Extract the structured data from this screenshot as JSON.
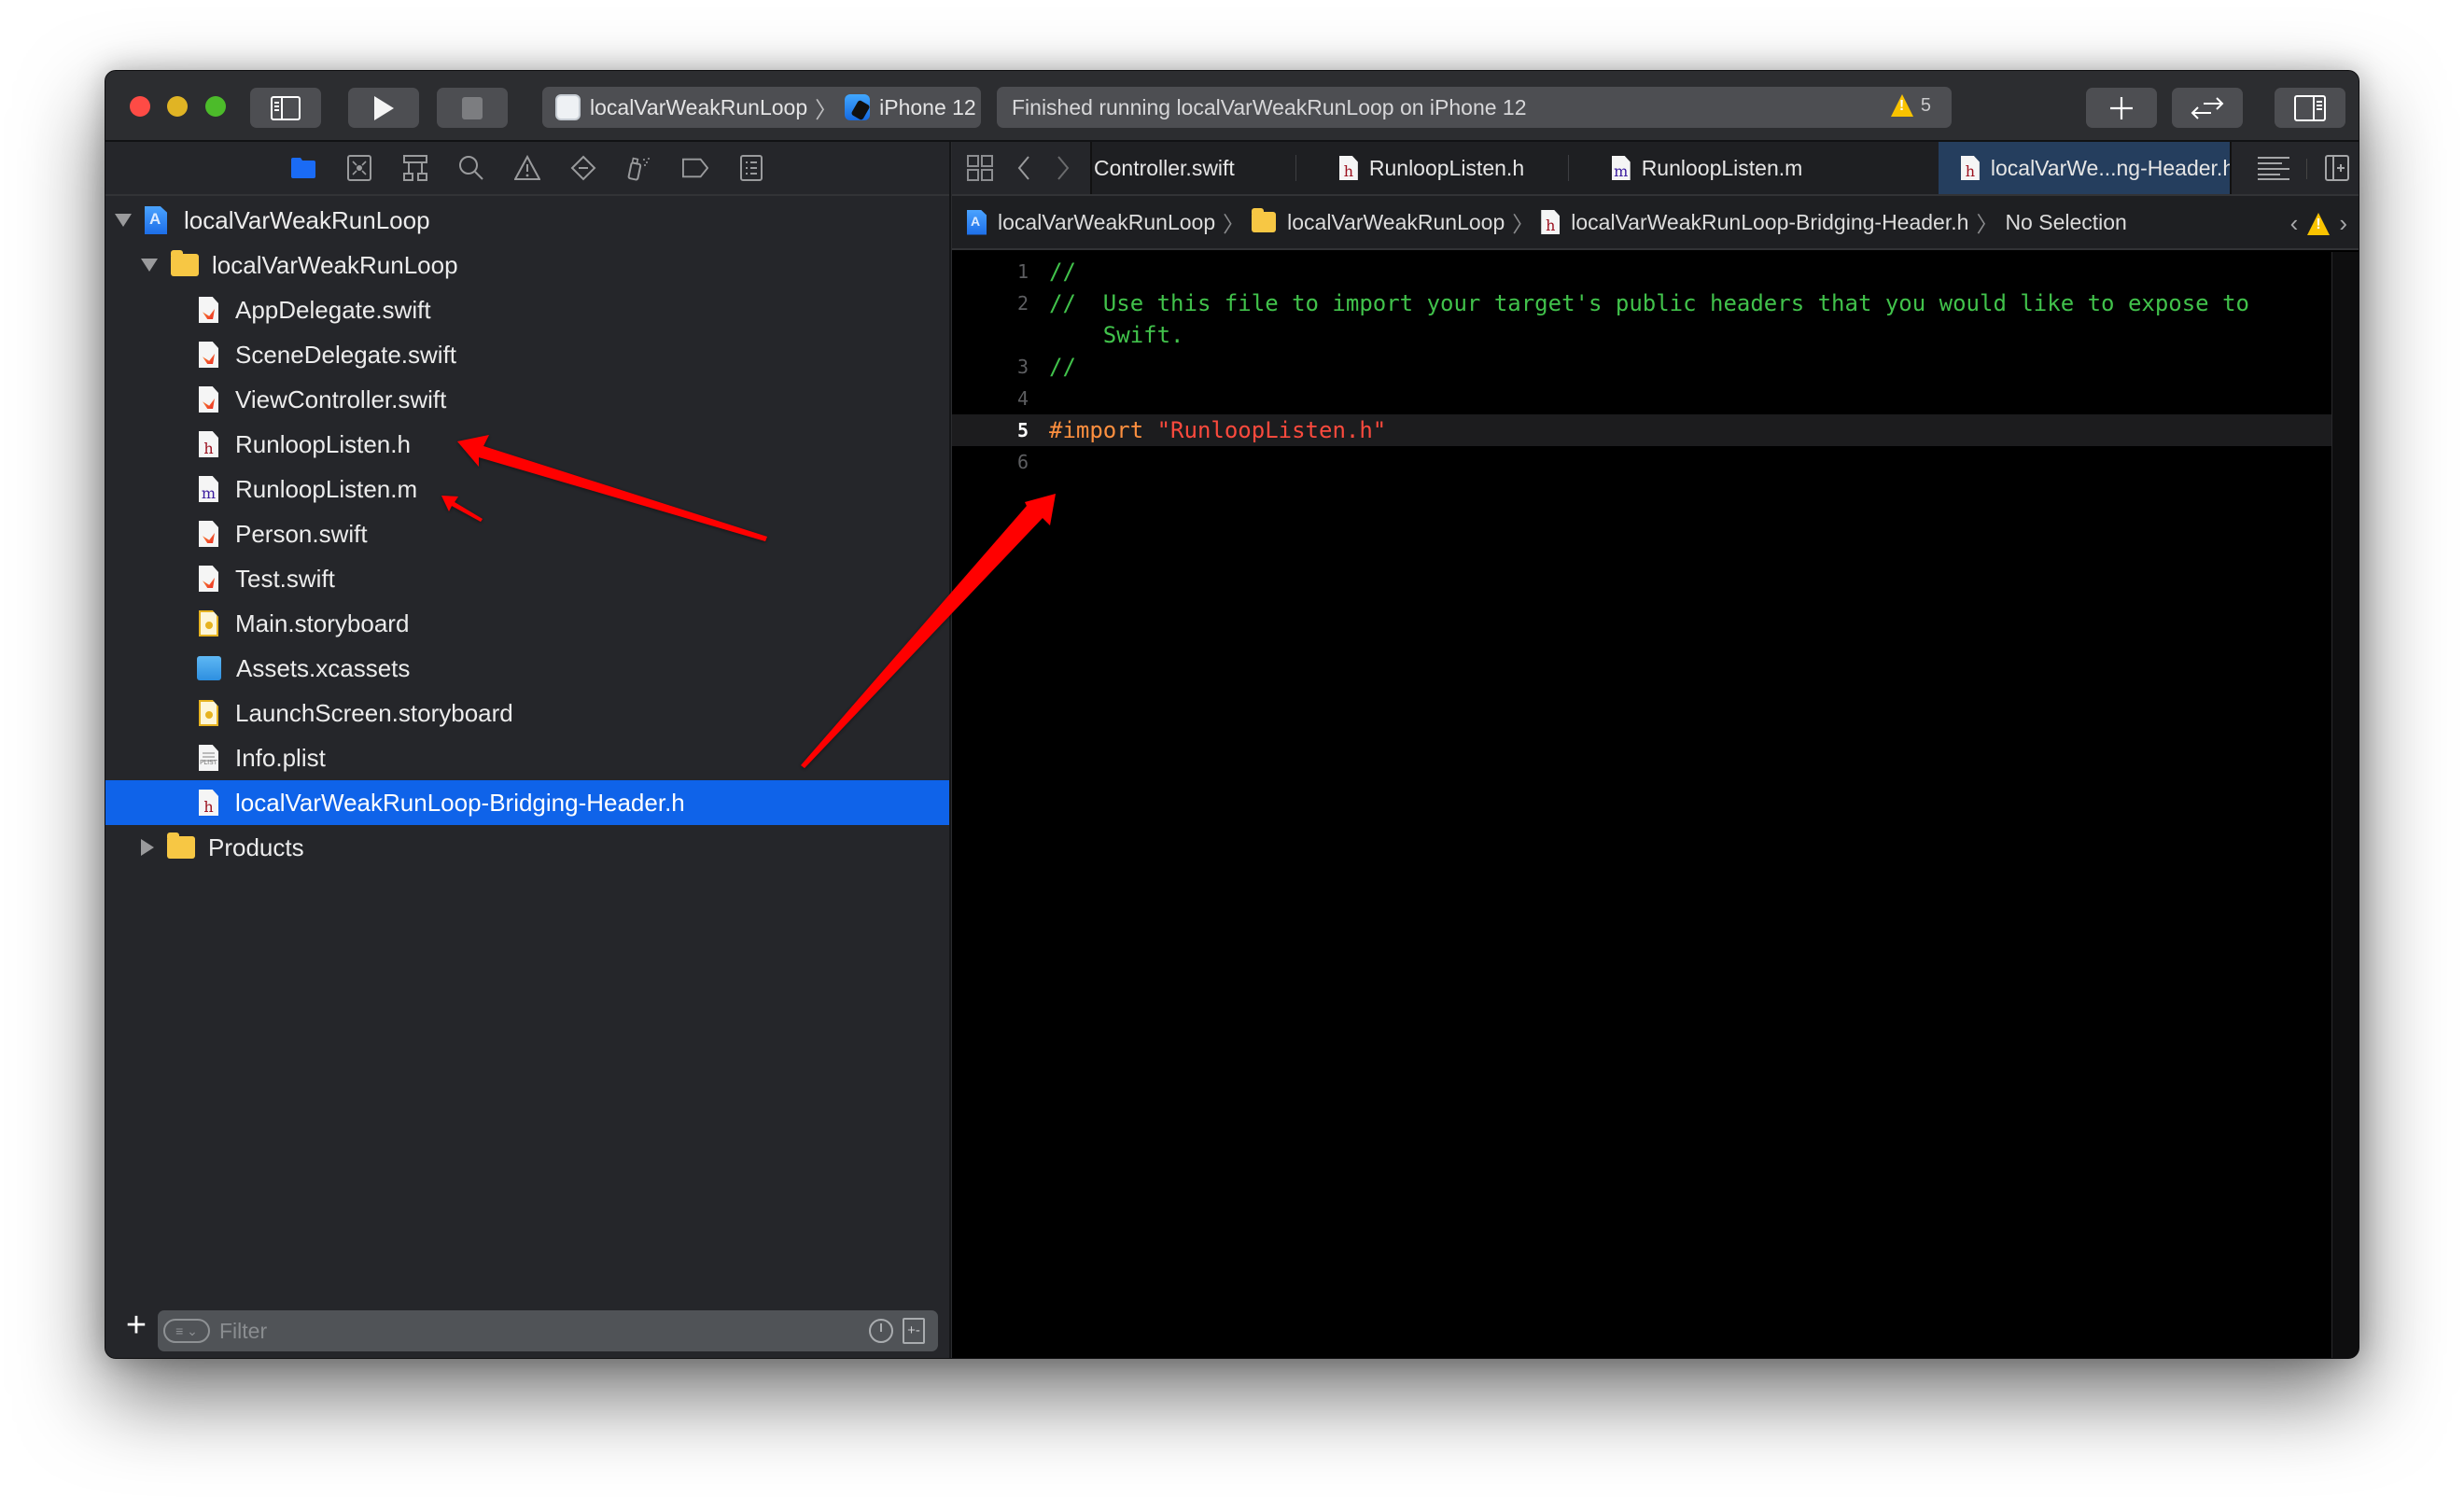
{
  "toolbar": {
    "scheme": "localVarWeakRunLoop",
    "device": "iPhone 12",
    "activity_status": "Finished running localVarWeakRunLoop on iPhone 12",
    "warning_count": "5",
    "icons": [
      "close",
      "minimize",
      "zoom",
      "navigator-toggle-icon",
      "run-icon",
      "stop-icon",
      "library-plus-icon",
      "code-review-icon",
      "inspector-toggle-icon"
    ]
  },
  "navigator": {
    "tabs": [
      "project-navigator",
      "source-control-navigator",
      "symbol-navigator",
      "find-navigator",
      "issue-navigator",
      "test-navigator",
      "debug-navigator",
      "breakpoint-navigator",
      "report-navigator"
    ],
    "active_tab": "project-navigator",
    "tree": [
      {
        "label": "localVarWeakRunLoop",
        "kind": "project",
        "depth": 0,
        "expanded": true
      },
      {
        "label": "localVarWeakRunLoop",
        "kind": "folder",
        "depth": 1,
        "expanded": true
      },
      {
        "label": "AppDelegate.swift",
        "kind": "swift",
        "depth": 2
      },
      {
        "label": "SceneDelegate.swift",
        "kind": "swift",
        "depth": 2
      },
      {
        "label": "ViewController.swift",
        "kind": "swift",
        "depth": 2
      },
      {
        "label": "RunloopListen.h",
        "kind": "h",
        "depth": 2
      },
      {
        "label": "RunloopListen.m",
        "kind": "m",
        "depth": 2
      },
      {
        "label": "Person.swift",
        "kind": "swift",
        "depth": 2
      },
      {
        "label": "Test.swift",
        "kind": "swift",
        "depth": 2
      },
      {
        "label": "Main.storyboard",
        "kind": "storyboard",
        "depth": 2
      },
      {
        "label": "Assets.xcassets",
        "kind": "assets",
        "depth": 2
      },
      {
        "label": "LaunchScreen.storyboard",
        "kind": "storyboard",
        "depth": 2
      },
      {
        "label": "Info.plist",
        "kind": "plist",
        "depth": 2
      },
      {
        "label": "localVarWeakRunLoop-Bridging-Header.h",
        "kind": "h",
        "depth": 2,
        "selected": true
      },
      {
        "label": "Products",
        "kind": "folder",
        "depth": 1,
        "expanded": false
      }
    ],
    "filter_placeholder": "Filter",
    "add_label": "+"
  },
  "editor": {
    "tabs": [
      {
        "label": "Controller.swift",
        "kind": "none",
        "active": false
      },
      {
        "label": "RunloopListen.h",
        "kind": "h",
        "active": false
      },
      {
        "label": "RunloopListen.m",
        "kind": "m",
        "active": false
      },
      {
        "label": "localVarWe...ng-Header.h",
        "kind": "h",
        "active": true
      }
    ],
    "jumpbar": {
      "project": "localVarWeakRunLoop",
      "group": "localVarWeakRunLoop",
      "file": "localVarWeakRunLoop-Bridging-Header.h",
      "selection": "No Selection"
    },
    "lines": [
      {
        "number": "1",
        "parts": [
          {
            "cls": "comment",
            "text": "//"
          }
        ]
      },
      {
        "number": "2",
        "parts": [
          {
            "cls": "comment",
            "text": "//  Use this file to import your target's public headers that you would like to expose to"
          }
        ]
      },
      {
        "number": "",
        "parts": [
          {
            "cls": "comment",
            "text": "    Swift."
          }
        ]
      },
      {
        "number": "3",
        "parts": [
          {
            "cls": "comment",
            "text": "//"
          }
        ]
      },
      {
        "number": "4",
        "parts": []
      },
      {
        "number": "5",
        "current": true,
        "parts": [
          {
            "cls": "pre",
            "text": "#import"
          },
          {
            "cls": "plain",
            "text": " "
          },
          {
            "cls": "str",
            "text": "\"RunloopListen.h\""
          }
        ]
      },
      {
        "number": "6",
        "parts": []
      }
    ]
  },
  "colors": {
    "selection": "#0f63e9",
    "comment": "#41c24b",
    "preprocessor": "#fd8f3f",
    "string": "#fc4a3d",
    "annotation_arrow": "#ff0000"
  },
  "annotations": [
    {
      "type": "arrow",
      "from": "sidebar-empty-area",
      "to": "RunloopListen.h"
    },
    {
      "type": "arrow",
      "from": "sidebar-empty-area",
      "to": "RunloopListen.m"
    },
    {
      "type": "arrow",
      "from": "localVarWeakRunLoop-Bridging-Header.h",
      "to": "#import line"
    }
  ]
}
